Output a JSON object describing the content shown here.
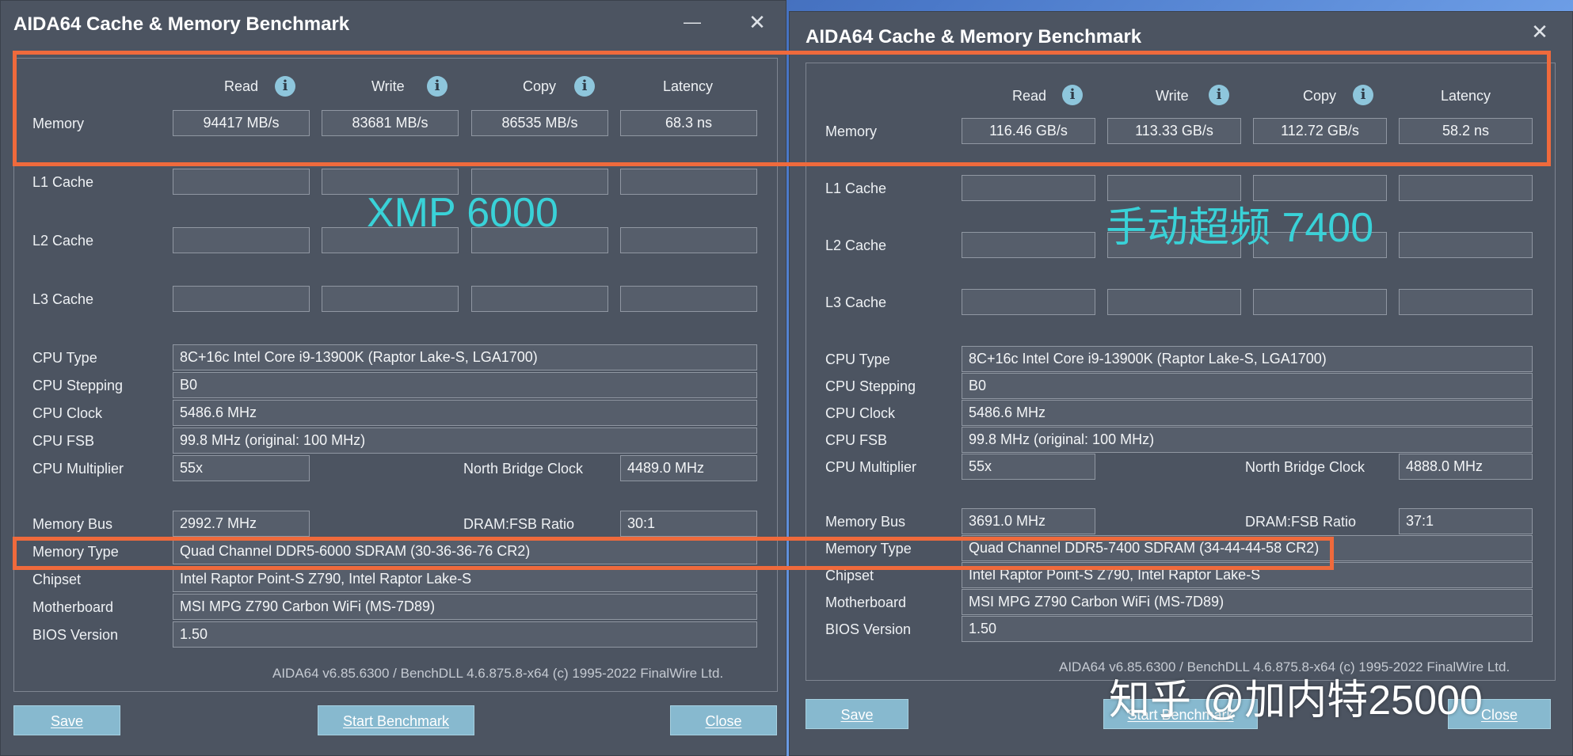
{
  "left": {
    "title": "AIDA64 Cache & Memory Benchmark",
    "overlay": "XMP 6000",
    "headers": {
      "read": "Read",
      "write": "Write",
      "copy": "Copy",
      "latency": "Latency"
    },
    "rows": {
      "memory": {
        "label": "Memory",
        "read": "94417 MB/s",
        "write": "83681 MB/s",
        "copy": "86535 MB/s",
        "latency": "68.3 ns"
      },
      "l1": {
        "label": "L1 Cache"
      },
      "l2": {
        "label": "L2 Cache"
      },
      "l3": {
        "label": "L3 Cache"
      }
    },
    "info": {
      "cpu_type": {
        "label": "CPU Type",
        "value": "8C+16c Intel Core i9-13900K  (Raptor Lake-S, LGA1700)"
      },
      "cpu_stepping": {
        "label": "CPU Stepping",
        "value": "B0"
      },
      "cpu_clock": {
        "label": "CPU Clock",
        "value": "5486.6 MHz"
      },
      "cpu_fsb": {
        "label": "CPU FSB",
        "value": "99.8 MHz  (original: 100 MHz)"
      },
      "cpu_multiplier": {
        "label": "CPU Multiplier",
        "value": "55x"
      },
      "nb_clock": {
        "label": "North Bridge Clock",
        "value": "4489.0 MHz"
      },
      "memory_bus": {
        "label": "Memory Bus",
        "value": "2992.7 MHz"
      },
      "dram_fsb": {
        "label": "DRAM:FSB Ratio",
        "value": "30:1"
      },
      "memory_type": {
        "label": "Memory Type",
        "value": "Quad Channel DDR5-6000 SDRAM  (30-36-36-76 CR2)"
      },
      "chipset": {
        "label": "Chipset",
        "value": "Intel Raptor Point-S Z790, Intel Raptor Lake-S"
      },
      "motherboard": {
        "label": "Motherboard",
        "value": "MSI MPG Z790 Carbon WiFi (MS-7D89)"
      },
      "bios": {
        "label": "BIOS Version",
        "value": "1.50"
      }
    },
    "footer": "AIDA64 v6.85.6300 / BenchDLL 4.6.875.8-x64  (c) 1995-2022 FinalWire Ltd.",
    "buttons": {
      "save": "Save",
      "start": "Start Benchmark",
      "close": "Close"
    }
  },
  "right": {
    "title": "AIDA64 Cache & Memory Benchmark",
    "overlay": "手动超频 7400",
    "headers": {
      "read": "Read",
      "write": "Write",
      "copy": "Copy",
      "latency": "Latency"
    },
    "rows": {
      "memory": {
        "label": "Memory",
        "read": "116.46 GB/s",
        "write": "113.33 GB/s",
        "copy": "112.72 GB/s",
        "latency": "58.2 ns"
      },
      "l1": {
        "label": "L1 Cache"
      },
      "l2": {
        "label": "L2 Cache"
      },
      "l3": {
        "label": "L3 Cache"
      }
    },
    "info": {
      "cpu_type": {
        "label": "CPU Type",
        "value": "8C+16c Intel Core i9-13900K  (Raptor Lake-S, LGA1700)"
      },
      "cpu_stepping": {
        "label": "CPU Stepping",
        "value": "B0"
      },
      "cpu_clock": {
        "label": "CPU Clock",
        "value": "5486.6 MHz"
      },
      "cpu_fsb": {
        "label": "CPU FSB",
        "value": "99.8 MHz  (original: 100 MHz)"
      },
      "cpu_multiplier": {
        "label": "CPU Multiplier",
        "value": "55x"
      },
      "nb_clock": {
        "label": "North Bridge Clock",
        "value": "4888.0 MHz"
      },
      "memory_bus": {
        "label": "Memory Bus",
        "value": "3691.0 MHz"
      },
      "dram_fsb": {
        "label": "DRAM:FSB Ratio",
        "value": "37:1"
      },
      "memory_type": {
        "label": "Memory Type",
        "value": "Quad Channel DDR5-7400 SDRAM  (34-44-44-58 CR2)"
      },
      "chipset": {
        "label": "Chipset",
        "value": "Intel Raptor Point-S Z790, Intel Raptor Lake-S"
      },
      "motherboard": {
        "label": "Motherboard",
        "value": "MSI MPG Z790 Carbon WiFi (MS-7D89)"
      },
      "bios": {
        "label": "BIOS Version",
        "value": "1.50"
      }
    },
    "footer": "AIDA64 v6.85.6300 / BenchDLL 4.6.875.8-x64  (c) 1995-2022 FinalWire Ltd.",
    "buttons": {
      "save": "Save",
      "start": "Start Benchmark",
      "close": "Close"
    }
  },
  "watermark": "知乎 @加内特25000",
  "colors": {
    "window_bg": "#4c5461",
    "button": "#87b9cf",
    "highlight": "#ef6a3c",
    "overlay_text": "#39d2d8"
  }
}
